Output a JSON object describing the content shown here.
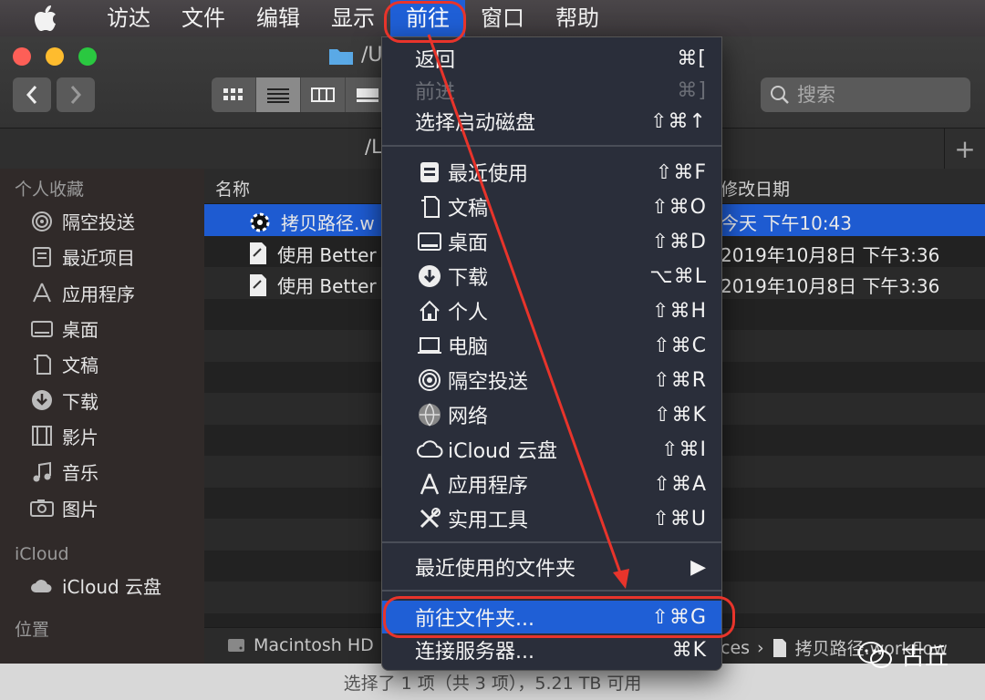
{
  "menubar": {
    "items": [
      {
        "label": "访达"
      },
      {
        "label": "文件"
      },
      {
        "label": "编辑"
      },
      {
        "label": "显示"
      },
      {
        "label": "前往"
      },
      {
        "label": "窗口"
      },
      {
        "label": "帮助"
      }
    ]
  },
  "window": {
    "title_fragment": "/U",
    "path_fragment": "/L",
    "search_placeholder": "搜索"
  },
  "sidebar": {
    "favorites_heading": "个人收藏",
    "favorites": [
      {
        "label": "隔空投送",
        "icon": "airdrop-icon"
      },
      {
        "label": "最近项目",
        "icon": "recents-icon"
      },
      {
        "label": "应用程序",
        "icon": "applications-icon"
      },
      {
        "label": "桌面",
        "icon": "desktop-icon"
      },
      {
        "label": "文稿",
        "icon": "documents-icon"
      },
      {
        "label": "下载",
        "icon": "downloads-icon"
      },
      {
        "label": "影片",
        "icon": "movies-icon"
      },
      {
        "label": "音乐",
        "icon": "music-icon"
      },
      {
        "label": "图片",
        "icon": "pictures-icon"
      }
    ],
    "icloud_heading": "iCloud",
    "icloud_item": "iCloud 云盘",
    "locations_heading": "位置"
  },
  "content": {
    "col_name": "名称",
    "col_date": "修改日期",
    "rows": [
      {
        "name": "拷贝路径.w",
        "date": "今天 下午10:43",
        "selected": true
      },
      {
        "name": "使用 Better",
        "date": "2019年10月8日 下午3:36",
        "selected": false
      },
      {
        "name": "使用 Better",
        "date": "2019年10月8日 下午3:36",
        "selected": false
      }
    ]
  },
  "bottom_path": {
    "disk": "Macintosh HD",
    "tail": "ces",
    "file": "拷贝路径.workflow"
  },
  "status": "选择了 1 项（共 3 项），5.21 TB 可用",
  "dropdown": {
    "group1": [
      {
        "label": "返回",
        "shortcut": "⌘[",
        "disabled": false
      },
      {
        "label": "前进",
        "shortcut": "⌘]",
        "disabled": true
      },
      {
        "label": "选择启动磁盘",
        "shortcut": "⇧⌘↑",
        "disabled": false
      }
    ],
    "group2": [
      {
        "label": "最近使用",
        "shortcut": "⇧⌘F",
        "icon": "recents-icon"
      },
      {
        "label": "文稿",
        "shortcut": "⇧⌘O",
        "icon": "documents-icon"
      },
      {
        "label": "桌面",
        "shortcut": "⇧⌘D",
        "icon": "desktop-icon"
      },
      {
        "label": "下载",
        "shortcut": "⌥⌘L",
        "icon": "downloads-icon"
      },
      {
        "label": "个人",
        "shortcut": "⇧⌘H",
        "icon": "home-icon"
      },
      {
        "label": "电脑",
        "shortcut": "⇧⌘C",
        "icon": "computer-icon"
      },
      {
        "label": "隔空投送",
        "shortcut": "⇧⌘R",
        "icon": "airdrop-icon"
      },
      {
        "label": "网络",
        "shortcut": "⇧⌘K",
        "icon": "network-icon"
      },
      {
        "label": "iCloud 云盘",
        "shortcut": "⇧⌘I",
        "icon": "cloud-icon"
      },
      {
        "label": "应用程序",
        "shortcut": "⇧⌘A",
        "icon": "applications-icon"
      },
      {
        "label": "实用工具",
        "shortcut": "⇧⌘U",
        "icon": "utilities-icon"
      }
    ],
    "recent_folders": {
      "label": "最近使用的文件夹",
      "arrow": "▶"
    },
    "goto_folder": {
      "label": "前往文件夹...",
      "shortcut": "⇧⌘G"
    },
    "connect_server": {
      "label": "连接服务器...",
      "shortcut": "⌘K"
    }
  },
  "watermark": "古丘",
  "colors": {
    "accent": "#1f5fd6",
    "annotation": "#e8342b"
  }
}
